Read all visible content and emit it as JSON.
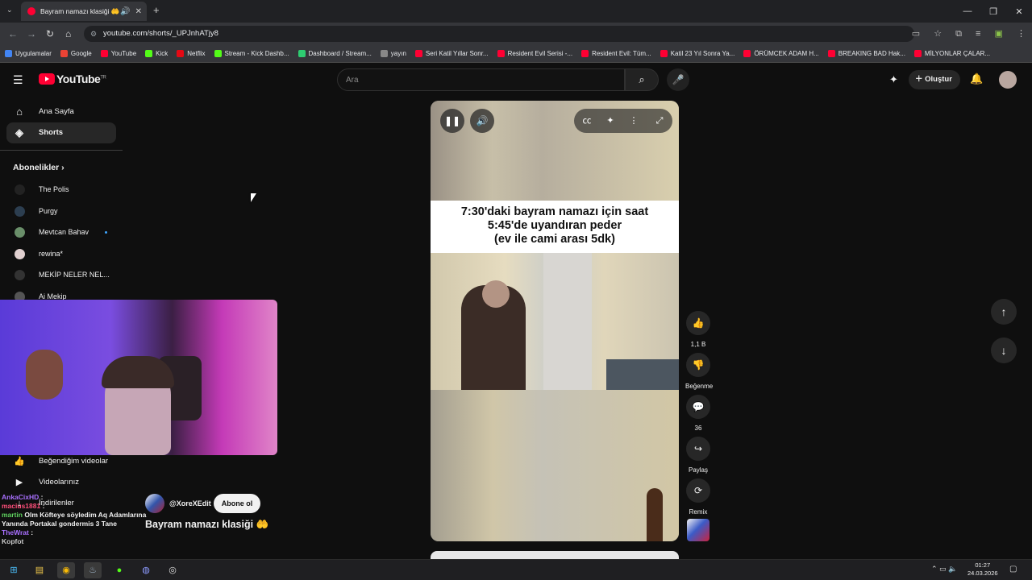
{
  "browser": {
    "tab_title": "Bayram namazı klasiği 🤲",
    "url": "youtube.com/shorts/_UPJnhATjy8",
    "bookmarks": [
      {
        "label": "Uygulamalar",
        "color": "#4285f4"
      },
      {
        "label": "Google",
        "color": "#ea4335"
      },
      {
        "label": "YouTube",
        "color": "#ff0033"
      },
      {
        "label": "Kick",
        "color": "#53fc18"
      },
      {
        "label": "Netflix",
        "color": "#e50914"
      },
      {
        "label": "Stream - Kick Dashb...",
        "color": "#53fc18"
      },
      {
        "label": "Dashboard / Stream...",
        "color": "#2ecc71"
      },
      {
        "label": "yayın",
        "color": "#888888"
      },
      {
        "label": "Seri Katil Yıllar Sonr...",
        "color": "#ff0033"
      },
      {
        "label": "Resident Evil Serisi -...",
        "color": "#ff0033"
      },
      {
        "label": "Resident Evil: Tüm...",
        "color": "#ff0033"
      },
      {
        "label": "Katil 23 Yıl Sonra Ya...",
        "color": "#ff0033"
      },
      {
        "label": "ÖRÜMCEK ADAM H...",
        "color": "#ff0033"
      },
      {
        "label": "BREAKING BAD Hak...",
        "color": "#ff0033"
      },
      {
        "label": "MİLYONLAR ÇALAR...",
        "color": "#ff0033"
      }
    ]
  },
  "yt": {
    "logo_text": "YouTube",
    "region": "TR",
    "search_placeholder": "Ara",
    "create_label": "Oluştur"
  },
  "sidebar": {
    "home": "Ana Sayfa",
    "shorts": "Shorts",
    "subs_header": "Abonelikler",
    "subs": [
      {
        "name": "The Polis",
        "color": "#222222"
      },
      {
        "name": "Purgy",
        "color": "#2c3e50"
      },
      {
        "name": "Mevtcan Bahav",
        "color": "#6a8f6a"
      },
      {
        "name": "rewina*",
        "color": "#e0d0d0"
      },
      {
        "name": "MEKİP NELER NEL...",
        "color": "#333333"
      },
      {
        "name": "Ai Mekip",
        "color": "#555555"
      }
    ],
    "liked": "Beğendiğim videolar",
    "your_videos": "Videolarınız",
    "downloads": "İndirilenler"
  },
  "chat": [
    {
      "user": "AnkaCixHD",
      "text": ":",
      "color": "#a970ff"
    },
    {
      "user": "macius1881",
      "text": ":",
      "color": "#ff4f7a"
    },
    {
      "user": "martin",
      "text": "Olm Köfteye söyledim Aq Adamlarına Yanında Portakal gondermis 3 Tane",
      "color": "#5fd35f"
    },
    {
      "user": "TheWrat",
      "text": ":",
      "color": "#a970ff"
    },
    {
      "user": "Kopfot",
      "text": "",
      "color": "#cccccc"
    }
  ],
  "short": {
    "channel": "@XoreXEdit",
    "subscribe": "Abone ol",
    "title": "Bayram namazı klasiği 🤲",
    "caption_line1": "7:30'daki bayram namazı için saat",
    "caption_line2": "5:45'de uyandıran peder",
    "caption_line3": "(ev ile cami arası 5dk)",
    "likes": "1,1 B",
    "dislike_label": "Beğenme",
    "comments": "36",
    "share_label": "Paylaş",
    "remix_label": "Remix"
  },
  "taskbar": {
    "time": "01:27",
    "date": "24.03.2026"
  }
}
